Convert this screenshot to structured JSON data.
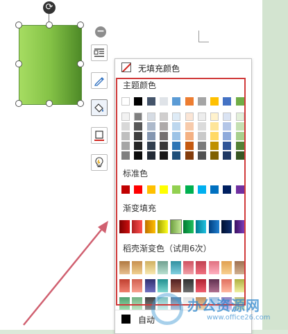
{
  "menu": {
    "no_fill_label": "无填充颜色",
    "theme_colors_label": "主题颜色",
    "standard_colors_label": "标准色",
    "gradient_fill_label": "渐变填充",
    "wps_gradient_label": "稻壳渐变色（试用6次）",
    "auto_label": "自动"
  },
  "watermark": {
    "title": "办公资源网",
    "url": "www.office26.com"
  },
  "side_toolbar": {
    "collapse_symbol": "−",
    "rotate_symbol": "⟳"
  },
  "colors": {
    "frame_highlight": "#d03a3a",
    "arrow": "#d06070",
    "shape_gradient": [
      "#a6dc62",
      "#84c246",
      "#4e8a27"
    ]
  },
  "palette": {
    "theme_top": [
      "#ffffff",
      "#000000",
      "#44546a",
      "#dfe3e8",
      "#5b9bd5",
      "#ed7d31",
      "#a5a5a5",
      "#ffc000",
      "#4472c4",
      "#70ad47"
    ],
    "theme_shades": [
      [
        "#f2f2f2",
        "#7f7f7f",
        "#d6dce4",
        "#d0cece",
        "#deebf6",
        "#fbe5d5",
        "#ededed",
        "#fff2cc",
        "#dae3f3",
        "#e2efd9"
      ],
      [
        "#d8d8d8",
        "#595959",
        "#adb9ca",
        "#aeaaaa",
        "#bdd7ee",
        "#f7cbac",
        "#dbdbdb",
        "#fee599",
        "#b4c6e7",
        "#c5e0b3"
      ],
      [
        "#bfbfbf",
        "#3f3f3f",
        "#8496b0",
        "#757070",
        "#9dc3e6",
        "#f4b183",
        "#c9c9c9",
        "#ffd965",
        "#8eaadb",
        "#a8d08d"
      ],
      [
        "#a5a5a5",
        "#262626",
        "#323f4f",
        "#3a3838",
        "#2e75b5",
        "#c55a11",
        "#7b7b7b",
        "#bf9000",
        "#2f5496",
        "#538135"
      ],
      [
        "#7f7f7f",
        "#0c0c0c",
        "#222a35",
        "#171616",
        "#1e4e79",
        "#833c0b",
        "#525252",
        "#7f6000",
        "#1f3864",
        "#375623"
      ]
    ],
    "standard": [
      "#c00000",
      "#ff0000",
      "#ffc000",
      "#ffff00",
      "#92d050",
      "#00b050",
      "#00b0f0",
      "#0070c0",
      "#002060",
      "#7030a0"
    ],
    "gradients": [
      [
        "#7a0000",
        "#d01010"
      ],
      [
        "#b02020",
        "#ff5050"
      ],
      [
        "#c07000",
        "#ffc000"
      ],
      [
        "#a0a000",
        "#ffff20"
      ],
      [
        "#6ea040",
        "#c4e894"
      ],
      [
        "#007a30",
        "#20c060"
      ],
      [
        "#007a90",
        "#20c0e0"
      ],
      [
        "#003f80",
        "#2080d0"
      ],
      [
        "#001030",
        "#103070"
      ],
      [
        "#3a1060",
        "#8040c0"
      ]
    ],
    "wps_row1": [
      [
        "#b07840",
        "#e8c090"
      ],
      [
        "#c89050",
        "#f0d090"
      ],
      [
        "#d0b060",
        "#f8e8b0"
      ],
      [
        "#70a090",
        "#b8e0d0"
      ],
      [
        "#3090a0",
        "#80d0e0"
      ],
      [
        "#d05060",
        "#f0a0a8"
      ],
      [
        "#c04050",
        "#f07080"
      ],
      [
        "#e07080",
        "#ffb0c0"
      ],
      [
        "#e0a050",
        "#f8d090"
      ],
      [
        "#a07050",
        "#d0b090"
      ]
    ],
    "wps_row2": [
      [
        "#c04030",
        "#f08070"
      ],
      [
        "#d06050",
        "#f8a090"
      ],
      [
        "#303070",
        "#7070c0"
      ],
      [
        "#209090",
        "#80d8d0"
      ],
      [
        "#502020",
        "#a06050"
      ],
      [
        "#303030",
        "#707070"
      ],
      [
        "#b02030",
        "#f06070"
      ],
      [
        "#603050",
        "#b07090"
      ],
      [
        "#e07060",
        "#ffb8a0"
      ],
      [
        "#b0b040",
        "#f0f0a0"
      ]
    ],
    "wps_row3": [
      [
        "#50a070",
        "#a0e0b0"
      ],
      [
        "#70b080",
        "#c0e8c8"
      ],
      [
        "#404040",
        "#909090"
      ],
      [
        "#80c0c0",
        "#d0f0f0"
      ],
      [
        "#6080a0",
        "#b0c8e0"
      ],
      [
        "#e0e0e0",
        "#ffffff"
      ],
      [
        "#c09060",
        "#f0d8b0"
      ],
      [
        "#a0c0e0",
        "#e0f0ff"
      ],
      [
        "#9080c0",
        "#d0c8f0"
      ],
      [
        "#c0c080",
        "#f0f0c0"
      ]
    ]
  }
}
